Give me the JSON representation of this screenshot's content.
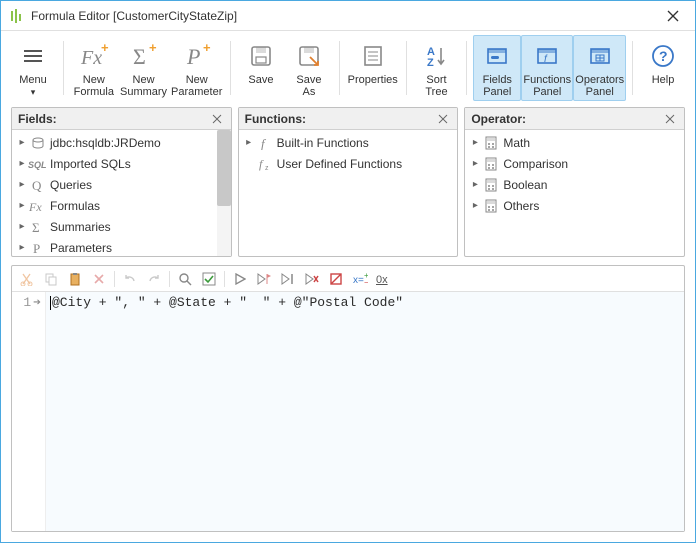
{
  "window": {
    "title": "Formula Editor  [CustomerCityStateZip]"
  },
  "toolbar": {
    "menu": "Menu",
    "new_formula": "New\nFormula",
    "new_summary": "New\nSummary",
    "new_parameter": "New\nParameter",
    "save": "Save",
    "save_as": "Save As",
    "properties": "Properties",
    "sort_tree": "Sort\nTree",
    "fields_panel": "Fields\nPanel",
    "functions_panel": "Functions\nPanel",
    "operators_panel": "Operators\nPanel",
    "help": "Help"
  },
  "panels": {
    "fields": {
      "title": "Fields:",
      "items": [
        {
          "label": "jdbc:hsqldb:JRDemo",
          "icon": "db"
        },
        {
          "label": "Imported SQLs",
          "icon": "sql"
        },
        {
          "label": "Queries",
          "icon": "q"
        },
        {
          "label": "Formulas",
          "icon": "fx"
        },
        {
          "label": "Summaries",
          "icon": "sigma"
        },
        {
          "label": "Parameters",
          "icon": "p"
        }
      ]
    },
    "functions": {
      "title": "Functions:",
      "items": [
        {
          "label": "Built-in Functions",
          "icon": "f"
        },
        {
          "label": "User Defined Functions",
          "icon": "fsub"
        }
      ]
    },
    "operators": {
      "title": "Operator:",
      "items": [
        {
          "label": "Math",
          "icon": "calc"
        },
        {
          "label": "Comparison",
          "icon": "calc"
        },
        {
          "label": "Boolean",
          "icon": "calc"
        },
        {
          "label": "Others",
          "icon": "calc"
        }
      ]
    }
  },
  "editor": {
    "line_number": "1",
    "code": "@City + \", \" + @State + \"  \" + @\"Postal Code\""
  }
}
